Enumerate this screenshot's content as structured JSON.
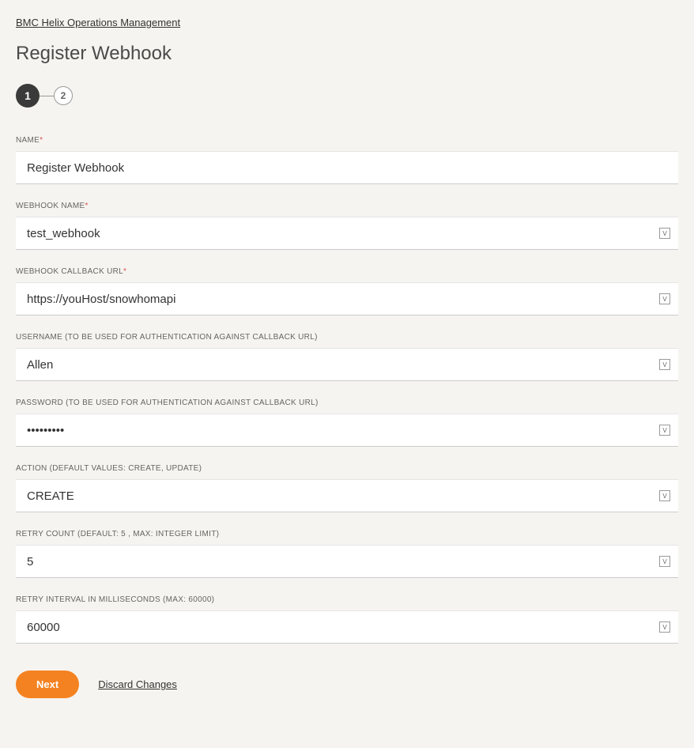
{
  "breadcrumb": "BMC Helix Operations Management",
  "page_title": "Register Webhook",
  "stepper": {
    "current": "1",
    "next": "2"
  },
  "fields": {
    "name": {
      "label": "NAME",
      "required": true,
      "value": "Register Webhook",
      "has_var": false
    },
    "webhook_name": {
      "label": "WEBHOOK NAME",
      "required": true,
      "value": "test_webhook",
      "has_var": true
    },
    "callback_url": {
      "label": "WEBHOOK CALLBACK URL",
      "required": true,
      "value": "https://youHost/snowhomapi",
      "has_var": true
    },
    "username": {
      "label": "USERNAME (TO BE USED FOR AUTHENTICATION AGAINST CALLBACK URL)",
      "required": false,
      "value": "Allen",
      "has_var": true
    },
    "password": {
      "label": "PASSWORD (TO BE USED FOR AUTHENTICATION AGAINST CALLBACK URL)",
      "required": false,
      "value": "•••••••••",
      "has_var": true
    },
    "action": {
      "label": "ACTION (DEFAULT VALUES: CREATE, UPDATE)",
      "required": false,
      "value": "CREATE",
      "has_var": true
    },
    "retry_count": {
      "label": "RETRY COUNT (DEFAULT: 5 , MAX: INTEGER LIMIT)",
      "required": false,
      "value": "5",
      "has_var": true
    },
    "retry_interval": {
      "label": "RETRY INTERVAL IN MILLISECONDS (MAX: 60000)",
      "required": false,
      "value": "60000",
      "has_var": true
    }
  },
  "var_badge": "V",
  "actions": {
    "next": "Next",
    "discard": "Discard Changes"
  }
}
